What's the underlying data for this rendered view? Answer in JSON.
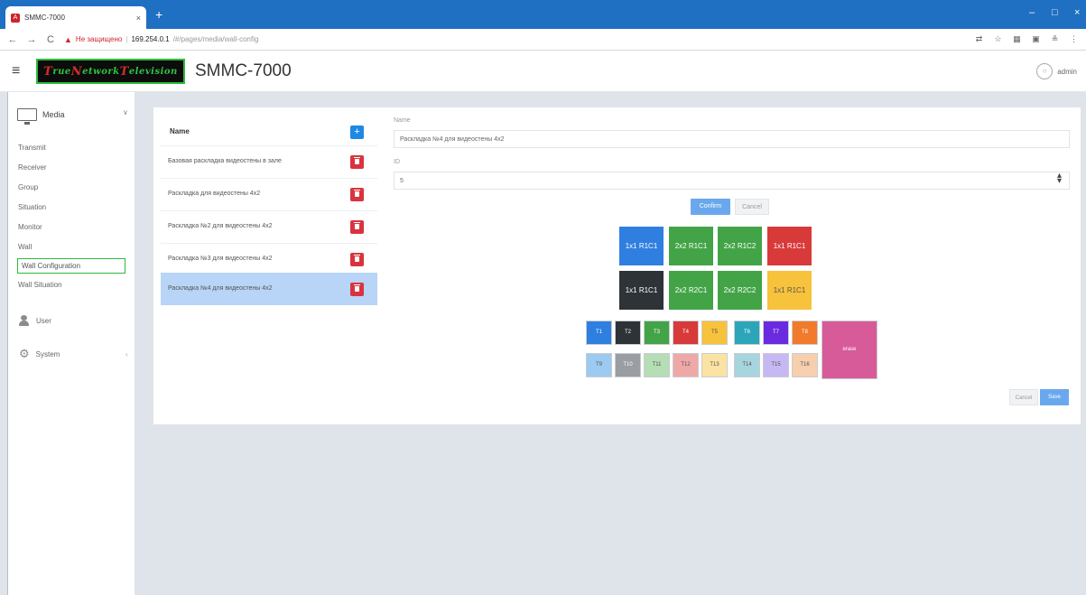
{
  "browser": {
    "tab_title": "SMMC-7000",
    "tab_close": "×",
    "new_tab": "+",
    "window_controls": [
      "–",
      "□",
      "×"
    ],
    "nav": {
      "back": "←",
      "forward": "→",
      "reload": "C"
    },
    "security_label": "Не защищено",
    "url_host": "169.254.0.1",
    "url_path": "/#/pages/media/wall-config",
    "separator": "|"
  },
  "header": {
    "menu_icon": "≡",
    "logo": {
      "w1_cap": "T",
      "w1_rest": "rue ",
      "w2_cap": "N",
      "w2_rest": "etwork ",
      "w3_cap": "T",
      "w3_rest": "elevision"
    },
    "title": "SMMC-7000",
    "user": "admin"
  },
  "sidebar": {
    "media_label": "Media",
    "media_chevron": "∨",
    "items": [
      "Transmit",
      "Receiver",
      "Group",
      "Situation",
      "Monitor",
      "Wall",
      "Wall Configuration",
      "Wall Situation"
    ],
    "user_label": "User",
    "system_label": "System",
    "system_chevron": "‹"
  },
  "list": {
    "header": "Name",
    "add_icon": "+",
    "rows": [
      "Базовая раскладка видеостены в зале",
      "Раскладка для видеостены 4x2",
      "Раскладка №2 для видеостены 4x2",
      "Раскладка №3 для видеостены 4x2",
      "Раскладка №4 для видеостены 4x2"
    ],
    "selected_index": 4
  },
  "form": {
    "name_label": "Name",
    "name_value": "Раскладка №4 для видеостены 4x2",
    "id_label": "ID",
    "id_value": "5",
    "confirm_label": "Confirm",
    "cancel_label": "Cancel"
  },
  "wall": {
    "rows": [
      [
        {
          "label": "1x1 R1C1",
          "color": "#2f7fe0"
        },
        {
          "label": "2x2 R1C1",
          "color": "#43a447"
        },
        {
          "label": "2x2 R1C2",
          "color": "#43a447"
        },
        {
          "label": "1x1 R1C1",
          "color": "#d83a3a"
        }
      ],
      [
        {
          "label": "1x1 R1C1",
          "color": "#2e3338"
        },
        {
          "label": "2x2 R2C1",
          "color": "#43a447"
        },
        {
          "label": "2x2 R2C2",
          "color": "#43a447"
        },
        {
          "label": "1x1 R1C1",
          "color": "#f7c23c"
        }
      ]
    ]
  },
  "sources": {
    "row1": [
      {
        "label": "T1",
        "color": "#2f7fe0"
      },
      {
        "label": "T2",
        "color": "#2e3338"
      },
      {
        "label": "T3",
        "color": "#43a447"
      },
      {
        "label": "T4",
        "color": "#d83a3a"
      },
      {
        "label": "T5",
        "color": "#f7c23c"
      },
      {
        "label": "T6",
        "color": "#2ba6b8"
      },
      {
        "label": "T7",
        "color": "#6a2be0"
      },
      {
        "label": "T8",
        "color": "#f17a2b"
      }
    ],
    "row2": [
      {
        "label": "T9",
        "color": "#9ccaf0"
      },
      {
        "label": "T10",
        "color": "#9a9ea3"
      },
      {
        "label": "T11",
        "color": "#b5ddb6"
      },
      {
        "label": "T12",
        "color": "#eea8a8"
      },
      {
        "label": "T13",
        "color": "#fbe3a4"
      },
      {
        "label": "T14",
        "color": "#a7d5de"
      },
      {
        "label": "T15",
        "color": "#c6b8f2"
      },
      {
        "label": "T16",
        "color": "#f8cfae"
      }
    ],
    "big": {
      "label": "erase",
      "color": "#d75b98"
    }
  },
  "footer": {
    "cancel_label": "Cancel",
    "save_label": "Save"
  }
}
